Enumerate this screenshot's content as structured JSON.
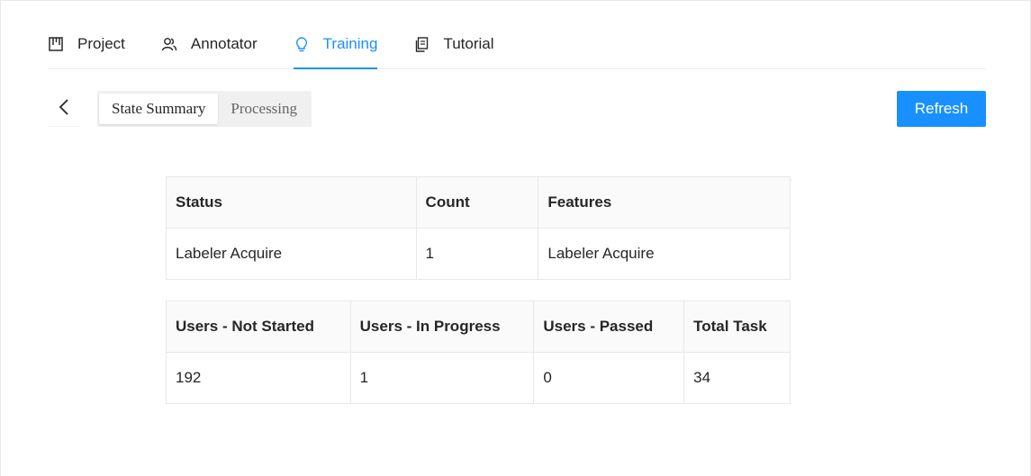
{
  "tabs": [
    {
      "label": "Project",
      "icon": "board-icon",
      "active": false
    },
    {
      "label": "Annotator",
      "icon": "users-icon",
      "active": false
    },
    {
      "label": "Training",
      "icon": "bulb-icon",
      "active": true
    },
    {
      "label": "Tutorial",
      "icon": "copy-icon",
      "active": false
    }
  ],
  "toolbar": {
    "segments": [
      "State Summary",
      "Processing"
    ],
    "active_segment": "State Summary",
    "refresh_label": "Refresh"
  },
  "summary_table": {
    "headers": [
      "Status",
      "Count",
      "Features"
    ],
    "rows": [
      [
        "Labeler Acquire",
        "1",
        "Labeler Acquire"
      ]
    ]
  },
  "users_table": {
    "headers": [
      "Users - Not Started",
      "Users - In Progress",
      "Users - Passed",
      "Total Task"
    ],
    "rows": [
      [
        "192",
        "1",
        "0",
        "34"
      ]
    ]
  },
  "colors": {
    "accent": "#1890ff"
  }
}
